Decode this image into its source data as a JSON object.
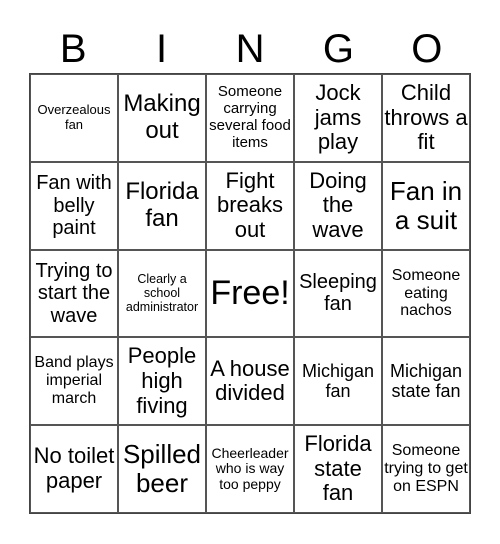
{
  "header": [
    "B",
    "I",
    "N",
    "G",
    "O"
  ],
  "cells": [
    "Overzealous fan",
    "Making out",
    "Someone carrying several food items",
    "Jock jams play",
    "Child throws a fit",
    "Fan with belly paint",
    "Florida fan",
    "Fight breaks out",
    "Doing the wave",
    "Fan in a suit",
    "Trying to start the wave",
    "Clearly a school administrator",
    "Free!",
    "Sleeping fan",
    "Someone eating nachos",
    "Band plays imperial march",
    "People high fiving",
    "A house divided",
    "Michigan fan",
    "Michigan state fan",
    "No toilet paper",
    "Spilled beer",
    "Cheerleader who is way too peppy",
    "Florida state fan",
    "Someone trying to get on ESPN"
  ]
}
